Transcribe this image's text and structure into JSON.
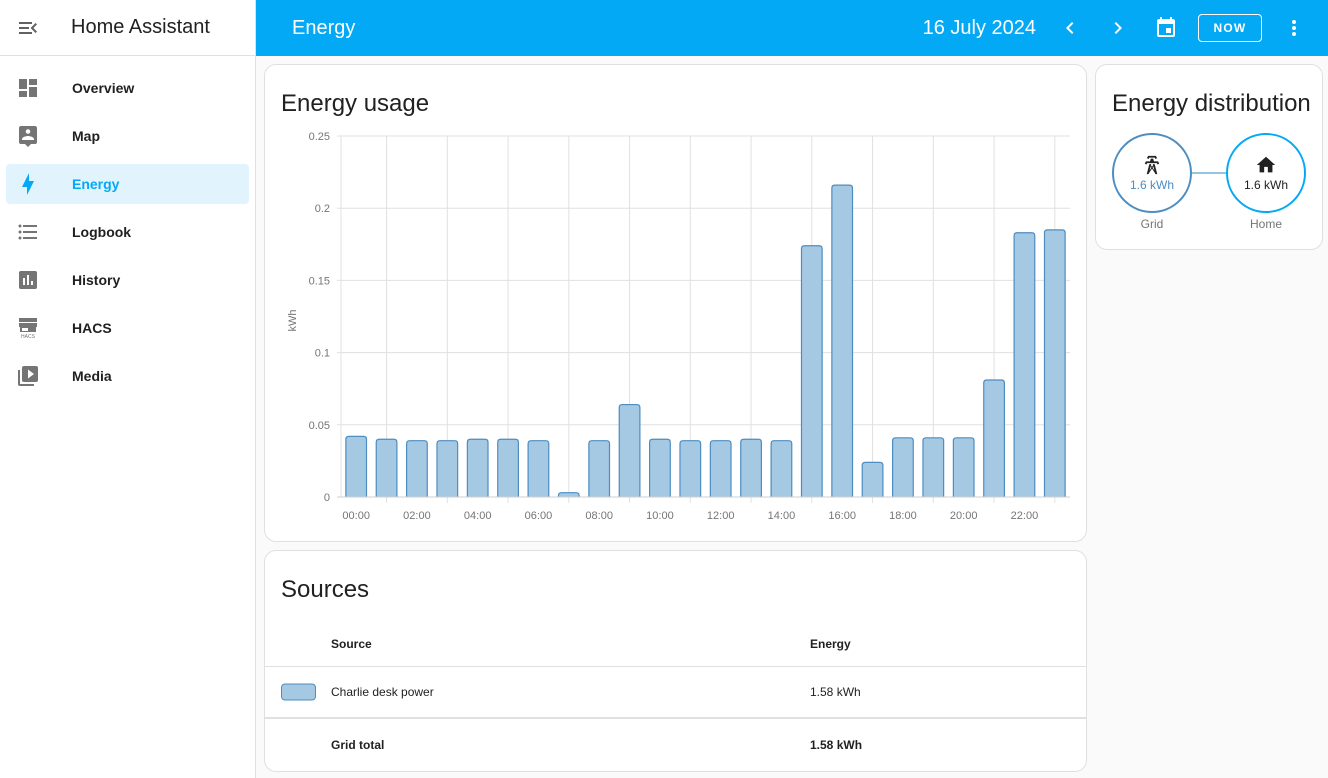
{
  "app": {
    "title": "Home Assistant"
  },
  "sidebar": {
    "items": [
      {
        "label": "Overview",
        "icon": "view-dashboard-icon",
        "active": false
      },
      {
        "label": "Map",
        "icon": "map-account-icon",
        "active": false
      },
      {
        "label": "Energy",
        "icon": "lightning-bolt-icon",
        "active": true
      },
      {
        "label": "Logbook",
        "icon": "format-list-icon",
        "active": false
      },
      {
        "label": "History",
        "icon": "chart-box-icon",
        "active": false
      },
      {
        "label": "HACS",
        "icon": "hacs-store-icon",
        "active": false
      },
      {
        "label": "Media",
        "icon": "play-box-multiple-icon",
        "active": false
      }
    ]
  },
  "topbar": {
    "title": "Energy",
    "date": "16 July 2024",
    "now_label": "NOW"
  },
  "colors": {
    "accent": "#03a9f4",
    "bar_fill": "#a5c8e3",
    "bar_stroke": "#4c8dc2",
    "grid_color": "#3f7fb5"
  },
  "usage": {
    "title": "Energy usage"
  },
  "chart_data": {
    "type": "bar",
    "title": "Energy usage",
    "xlabel": "",
    "ylabel": "kWh",
    "ylim": [
      0,
      0.25
    ],
    "yticks": [
      "0",
      "0.05",
      "0.1",
      "0.15",
      "0.2",
      "0.25"
    ],
    "grid": true,
    "xtick_labels": [
      "00:00",
      "02:00",
      "04:00",
      "06:00",
      "08:00",
      "10:00",
      "12:00",
      "14:00",
      "16:00",
      "18:00",
      "20:00",
      "22:00"
    ],
    "categories": [
      "00:00",
      "01:00",
      "02:00",
      "03:00",
      "04:00",
      "05:00",
      "06:00",
      "07:00",
      "08:00",
      "09:00",
      "10:00",
      "11:00",
      "12:00",
      "13:00",
      "14:00",
      "15:00",
      "16:00",
      "17:00",
      "18:00",
      "19:00",
      "20:00",
      "21:00",
      "22:00",
      "23:00"
    ],
    "series": [
      {
        "name": "Charlie desk power",
        "values": [
          0.042,
          0.04,
          0.039,
          0.039,
          0.04,
          0.04,
          0.039,
          0.003,
          0.039,
          0.064,
          0.04,
          0.039,
          0.039,
          0.04,
          0.039,
          0.174,
          0.216,
          0.024,
          0.041,
          0.041,
          0.041,
          0.081,
          0.183,
          0.185
        ]
      }
    ]
  },
  "distribution": {
    "title": "Energy distribution",
    "grid": {
      "label": "Grid",
      "value": "1.6 kWh"
    },
    "home": {
      "label": "Home",
      "value": "1.6 kWh"
    }
  },
  "sources": {
    "title": "Sources",
    "columns": [
      "Source",
      "Energy"
    ],
    "rows": [
      {
        "name": "Charlie desk power",
        "energy": "1.58 kWh"
      }
    ],
    "total": {
      "name": "Grid total",
      "energy": "1.58 kWh"
    }
  }
}
